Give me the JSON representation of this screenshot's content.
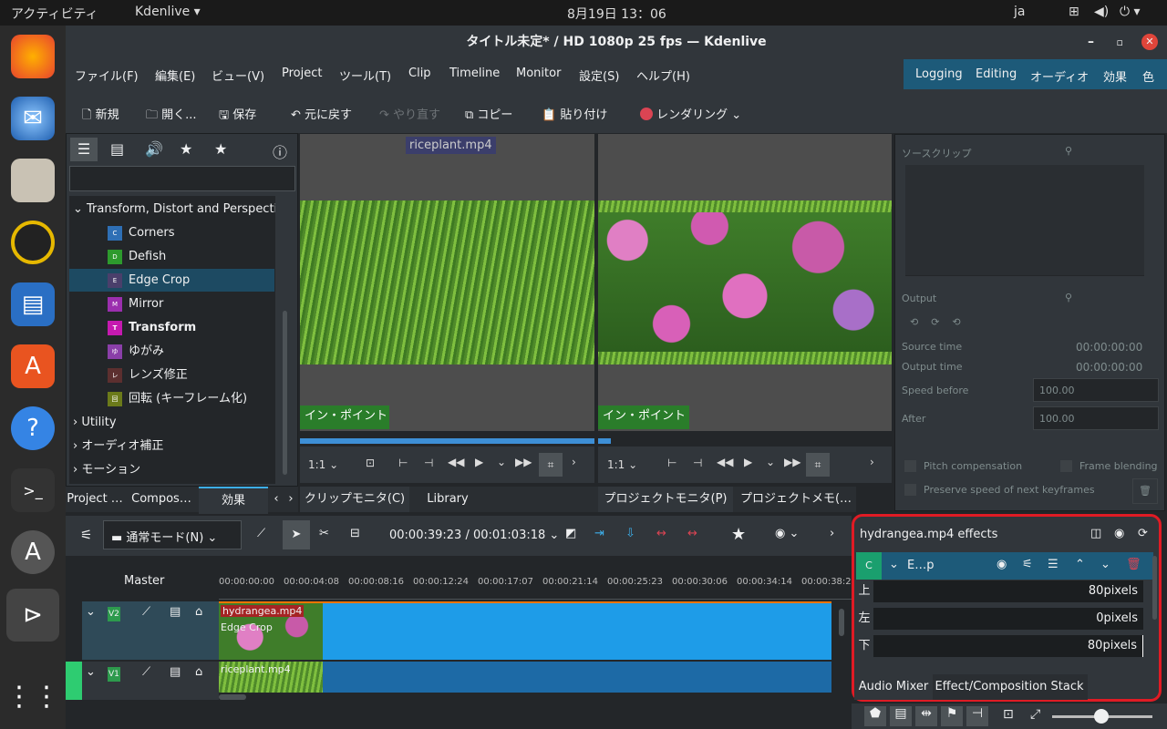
{
  "system_bar": {
    "activities": "アクティビティ",
    "app_name": "Kdenlive",
    "clock": "8月19日  13：06",
    "lang": "ja"
  },
  "window": {
    "title": "タイトル未定* / HD 1080p 25 fps — Kdenlive"
  },
  "menu": [
    "ファイル(F)",
    "編集(E)",
    "ビュー(V)",
    "Project",
    "ツール(T)",
    "Clip",
    "Timeline",
    "Monitor",
    "設定(S)",
    "ヘルプ(H)"
  ],
  "workspaces": [
    "Logging",
    "Editing",
    "オーディオ",
    "効果",
    "色"
  ],
  "toolbar": {
    "new": "新規",
    "open": "開く...",
    "save": "保存",
    "undo": "元に戻す",
    "redo": "やり直す",
    "copy": "コピー",
    "paste": "貼り付け",
    "render": "レンダリング"
  },
  "effects_tree": {
    "group": "Transform, Distort and Perspective",
    "items": [
      {
        "badge": "C",
        "label": "Corners",
        "color": "#2e6fb5"
      },
      {
        "badge": "D",
        "label": "Defish",
        "color": "#2d9a2d"
      },
      {
        "badge": "E",
        "label": "Edge Crop",
        "color": "#4a3f6b"
      },
      {
        "badge": "M",
        "label": "Mirror",
        "color": "#9b2fae"
      },
      {
        "badge": "T",
        "label": "Transform",
        "color": "#c51ab0"
      },
      {
        "badge": "ゆ",
        "label": "ゆがみ",
        "color": "#8a3fa8"
      },
      {
        "badge": "レ",
        "label": "レンズ修正",
        "color": "#5c2f2f"
      },
      {
        "badge": "回",
        "label": "回転 (キーフレーム化)",
        "color": "#6b7a1a"
      }
    ],
    "groups": [
      "Utility",
      "オーディオ補正",
      "モーション"
    ]
  },
  "left_tabs": [
    "Project …",
    "Compos…",
    "効果"
  ],
  "clip_monitor": {
    "clip_name": "riceplant.mp4",
    "in_point": "イン・ポイント",
    "zoom": "1:1"
  },
  "project_monitor": {
    "in_point": "イン・ポイント",
    "zoom": "1:1"
  },
  "monitor_tabs": [
    "クリップモニタ(C)",
    "Library",
    "プロジェクトモニタ(P)",
    "プロジェクトメモ(…"
  ],
  "speed_panel": {
    "source_clip": "ソースクリップ",
    "output": "Output",
    "source_time_label": "Source time",
    "source_time": "00:00:00:00",
    "output_time_label": "Output time",
    "output_time": "00:00:00:00",
    "speed_before_label": "Speed before",
    "speed_before": "100.00",
    "after_label": "After",
    "after": "100.00",
    "pitch": "Pitch compensation",
    "frame_blending": "Frame blending",
    "preserve": "Preserve speed of next keyframes"
  },
  "timeline": {
    "mode": "通常モード(N)",
    "timecode": "00:00:39:23 / 00:01:03:18",
    "master": "Master",
    "ruler": [
      "00:00:00:00",
      "00:00:04:08",
      "00:00:08:16",
      "00:00:12:24",
      "00:00:17:07",
      "00:00:21:14",
      "00:00:25:23",
      "00:00:30:06",
      "00:00:34:14",
      "00:00:38:2"
    ],
    "tracks": [
      {
        "name": "V2",
        "clip": "hydrangea.mp4",
        "effect": "Edge Crop"
      },
      {
        "name": "V1",
        "clip": "riceplant.mp4"
      }
    ]
  },
  "effect_stack": {
    "title": "hydrangea.mp4 effects",
    "effect_badge": "C",
    "effect_name": "E…p",
    "params": [
      {
        "label": "上",
        "value": "80pixels"
      },
      {
        "label": "左",
        "value": "0pixels"
      },
      {
        "label": "下",
        "value": "80pixels"
      }
    ],
    "tabs": [
      "Audio Mixer",
      "Effect/Composition Stack"
    ]
  }
}
